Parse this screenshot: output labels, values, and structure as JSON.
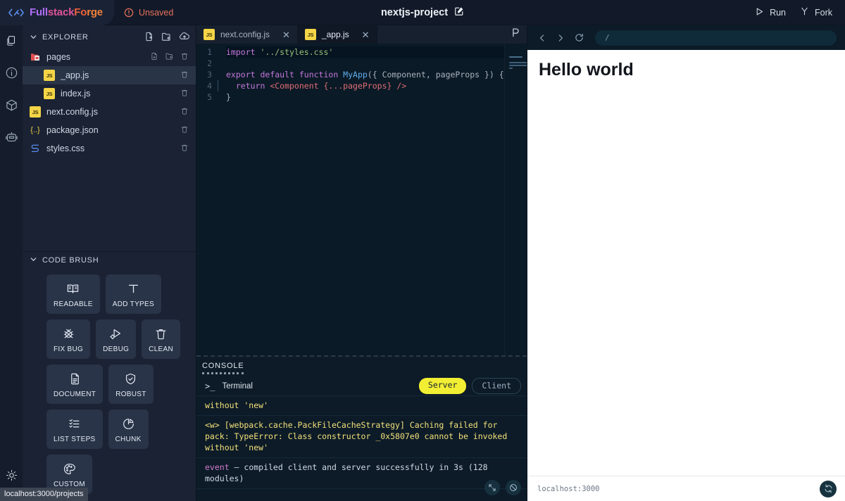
{
  "topbar": {
    "brand_icon": "code-brackets-icon",
    "brand_parts": [
      "Full",
      "stack",
      "Fo",
      "rge"
    ],
    "unsaved_icon": "alert-circle-icon",
    "unsaved_label": "Unsaved",
    "project_title": "nextjs-project",
    "project_edit_icon": "pencil-square-icon",
    "run_icon": "play-icon",
    "run_label": "Run",
    "fork_icon": "fork-icon",
    "fork_label": "Fork",
    "brand_colors": [
      "#b06ef7",
      "#e0529c",
      "#f0603c",
      "#f2803a"
    ],
    "unsaved_color": "#e8705a"
  },
  "rail": {
    "items": [
      {
        "name": "files-icon",
        "active": true
      },
      {
        "name": "info-icon",
        "active": false
      },
      {
        "name": "package-icon",
        "active": false
      },
      {
        "name": "robot-icon",
        "active": false
      }
    ],
    "theme_icon": "sun-icon"
  },
  "explorer": {
    "title": "EXPLORER",
    "chevron": "chevron-down-icon",
    "actions": [
      "new-file-icon",
      "new-folder-icon",
      "cloud-upload-icon"
    ],
    "files": [
      {
        "name": "pages",
        "type": "folder",
        "icon": "folder-open-icon",
        "indent": false,
        "selected": false,
        "actions": [
          "new-file-icon",
          "new-folder-icon",
          "trash-icon"
        ]
      },
      {
        "name": "_app.js",
        "type": "js",
        "icon": "js-icon",
        "indent": true,
        "selected": true,
        "actions": [
          "trash-icon"
        ]
      },
      {
        "name": "index.js",
        "type": "js",
        "icon": "js-icon",
        "indent": true,
        "selected": false,
        "actions": [
          "trash-icon"
        ]
      },
      {
        "name": "next.config.js",
        "type": "js",
        "icon": "js-icon",
        "indent": false,
        "selected": false,
        "actions": [
          "trash-icon"
        ]
      },
      {
        "name": "package.json",
        "type": "json",
        "icon": "json-icon",
        "indent": false,
        "selected": false,
        "actions": [
          "trash-icon"
        ]
      },
      {
        "name": "styles.css",
        "type": "css",
        "icon": "css-icon",
        "indent": false,
        "selected": false,
        "actions": [
          "trash-icon"
        ]
      }
    ]
  },
  "code_brush": {
    "title": "CODE BRUSH",
    "chevron": "chevron-down-icon",
    "buttons": [
      {
        "label": "READABLE",
        "icon": "book-open-icon"
      },
      {
        "label": "ADD TYPES",
        "icon": "text-t-icon"
      },
      {
        "label": "FIX BUG",
        "icon": "bug-icon"
      },
      {
        "label": "DEBUG",
        "icon": "debug-play-icon"
      },
      {
        "label": "CLEAN",
        "icon": "trash-icon"
      },
      {
        "label": "DOCUMENT",
        "icon": "document-icon"
      },
      {
        "label": "ROBUST",
        "icon": "shield-check-icon"
      },
      {
        "label": "LIST STEPS",
        "icon": "checklist-icon"
      },
      {
        "label": "CHUNK",
        "icon": "pie-chart-icon"
      },
      {
        "label": "CUSTOM",
        "icon": "palette-icon"
      }
    ]
  },
  "status_tip": "localhost:3000/projects",
  "editor": {
    "tabs": [
      {
        "label": "next.config.js",
        "icon": "js-icon",
        "active": false,
        "close_icon": "close-icon"
      },
      {
        "label": "_app.js",
        "icon": "js-icon",
        "active": true,
        "close_icon": "close-icon"
      }
    ],
    "tabbar_right_icon": "prettier-icon",
    "line_numbers": [
      "1",
      "2",
      "3",
      "4",
      "5"
    ],
    "lines": [
      [
        {
          "t": "import ",
          "c": "kw"
        },
        {
          "t": "'../styles.css'",
          "c": "str"
        }
      ],
      [],
      [
        {
          "t": "export ",
          "c": "kw"
        },
        {
          "t": "default ",
          "c": "kw"
        },
        {
          "t": "function ",
          "c": "kw"
        },
        {
          "t": "MyApp",
          "c": "fn"
        },
        {
          "t": "({ Component, pageProps }) {",
          "c": "pun"
        }
      ],
      [
        {
          "t": "  return ",
          "c": "kw"
        },
        {
          "t": "<Component ",
          "c": "tag"
        },
        {
          "t": "{...pageProps}",
          "c": "brace"
        },
        {
          "t": " />",
          "c": "tag"
        }
      ],
      [
        {
          "t": "}",
          "c": "pun"
        }
      ]
    ]
  },
  "console": {
    "title": "CONSOLE",
    "terminal_prompt": ">_",
    "terminal_label": "Terminal",
    "segments": [
      {
        "label": "Server",
        "active": true
      },
      {
        "label": "Client",
        "active": false
      }
    ],
    "logs": [
      {
        "text": "without 'new'",
        "kind": "warn"
      },
      {
        "text": "<w> [webpack.cache.PackFileCacheStrategy] Caching failed for pack: TypeError: Class constructor _0x5807e0 cannot be invoked without 'new'",
        "kind": "warn"
      },
      {
        "keyword": "event",
        "text": " — compiled client and server successfully in 3s (128 modules)",
        "kind": "event"
      }
    ],
    "tools": [
      "expand-icon",
      "clear-console-icon"
    ]
  },
  "preview": {
    "back_icon": "chevron-left-icon",
    "forward_icon": "chevron-right-icon",
    "reload_icon": "reload-icon",
    "url_value": "/",
    "page_heading": "Hello world",
    "status_text": "localhost:3000",
    "fab_icon": "refresh-icon"
  }
}
